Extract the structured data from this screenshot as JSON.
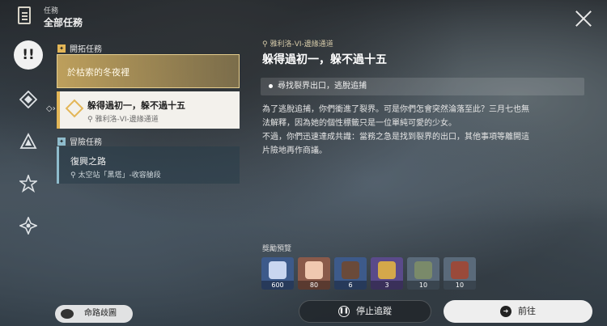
{
  "header": {
    "subtitle": "任務",
    "title": "全部任務",
    "close_icon": "close-icon"
  },
  "rail": {
    "active_glyph": "!!",
    "items": [
      "quest-trailblaze-icon",
      "quest-companion-icon",
      "quest-adventure-icon",
      "quest-daily-icon",
      "quest-other-icon"
    ]
  },
  "sections": {
    "trailblaze_label": "開拓任務",
    "adventure_label": "冒險任務"
  },
  "quests": {
    "first": {
      "title": "於枯索的冬夜裡"
    },
    "selected": {
      "title": "躲得過初一，躲不過十五",
      "location": "雅利洛-VI-邊緣通道"
    },
    "adventure": {
      "title": "復興之路",
      "location": "太空站「黑塔」-收容艙段"
    }
  },
  "detail": {
    "location": "雅利洛-VI-邊緣通道",
    "title": "躲得過初一，躲不過十五",
    "objective": "尋找裂界出口，逃脫追捕",
    "desc_line1": "為了逃脫追捕，你們衝進了裂界。可是你們怎會突然淪落至此？三月七也無",
    "desc_line2": "法解釋，因為她的個性標籤只是一位單純可愛的少女。",
    "desc_line3": "不過，你們迅速達成共識：當務之急是找到裂界的出口，其他事項等離開這",
    "desc_line4": "片險地再作商議。"
  },
  "rewards": {
    "label": "獎勵預覽",
    "items": [
      {
        "count": "600",
        "bg": "#3d5a8a",
        "art": "#c9d6f0"
      },
      {
        "count": "80",
        "bg": "#8a5a4a",
        "art": "#f0c8b0"
      },
      {
        "count": "6",
        "bg": "#3d5a8a",
        "art": "#6a4a3a"
      },
      {
        "count": "3",
        "bg": "#5a4a8a",
        "art": "#d4a84a"
      },
      {
        "count": "10",
        "bg": "#5a6a7a",
        "art": "#7a8a6a"
      },
      {
        "count": "10",
        "bg": "#5a6a7a",
        "art": "#9a4a3a"
      }
    ]
  },
  "buttons": {
    "map": "命路歧圖",
    "stop": "停止追蹤",
    "go": "前往"
  }
}
